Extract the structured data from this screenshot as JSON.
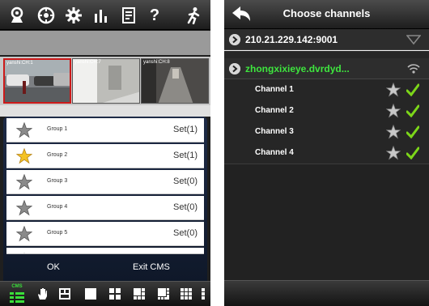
{
  "left": {
    "toolbar_icons": [
      "p2p-camera-icon",
      "ptz-icon",
      "settings-gear-icon",
      "statistics-icon",
      "log-icon",
      "help-icon",
      "exit-icon"
    ],
    "help_glyph": "?",
    "thumbnails": [
      {
        "label": "yanshi:CH:1"
      },
      {
        "label": "yanshi:CH:7"
      },
      {
        "label": "yanshi:CH:8"
      }
    ],
    "groups": [
      {
        "name": "Group 1",
        "set": "Set(1)",
        "star": "gray"
      },
      {
        "name": "Group 2",
        "set": "Set(1)",
        "star": "gold"
      },
      {
        "name": "Group 3",
        "set": "Set(0)",
        "star": "gray"
      },
      {
        "name": "Group 4",
        "set": "Set(0)",
        "star": "gray"
      },
      {
        "name": "Group 5",
        "set": "Set(0)",
        "star": "gray"
      }
    ],
    "ok_label": "OK",
    "exit_label": "Exit CMS",
    "bottom_bar": {
      "cms_label": "CMS",
      "icons": [
        "cms-icon",
        "hand-icon",
        "snapshot-icon",
        "layout-1-icon",
        "layout-4-icon",
        "layout-6-icon",
        "layout-8-icon",
        "layout-9-icon"
      ]
    }
  },
  "right": {
    "title": "Choose channels",
    "devices": [
      {
        "name": "210.21.229.142:9001",
        "color": "#ffffff"
      },
      {
        "name": "zhongxixieye.dvrdyd...",
        "color": "#3ee63e"
      }
    ],
    "channels": [
      "Channel 1",
      "Channel 2",
      "Channel 3",
      "Channel 4"
    ]
  },
  "colors": {
    "accent_green": "#3ee63e",
    "selection_red": "#cc1a1a",
    "sheet_navy": "#1e2b47"
  }
}
